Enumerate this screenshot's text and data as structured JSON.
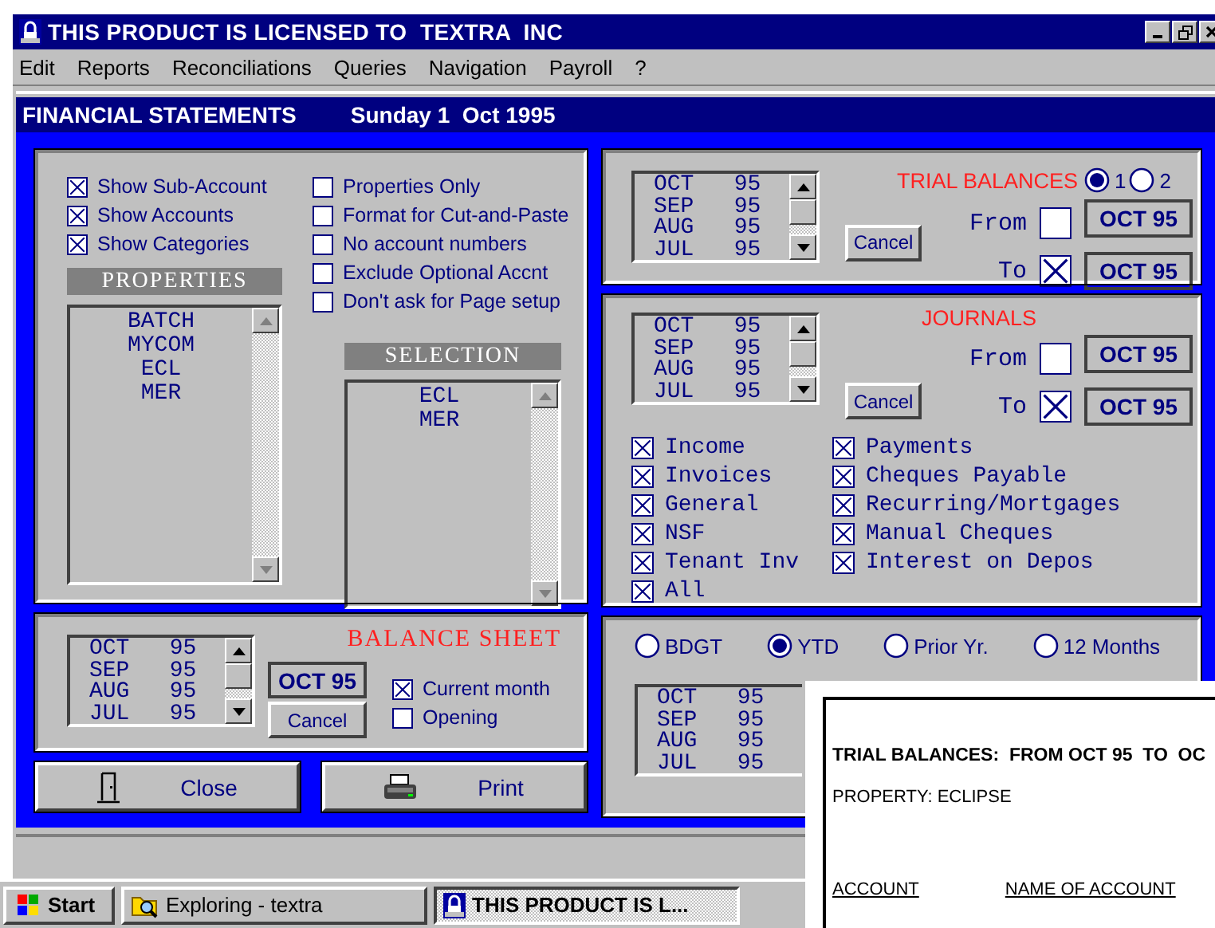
{
  "window": {
    "title": "THIS PRODUCT IS LICENSED TO  TEXTRA  INC"
  },
  "menu": [
    "Edit",
    "Reports",
    "Reconciliations",
    "Queries",
    "Navigation",
    "Payroll",
    "?"
  ],
  "dialog": {
    "title": "FINANCIAL STATEMENTS",
    "date": "Sunday 1  Oct 1995"
  },
  "options": {
    "left_checks": [
      {
        "label": "Show Sub-Account",
        "checked": true
      },
      {
        "label": "Show Accounts",
        "checked": true
      },
      {
        "label": "Show Categories",
        "checked": true
      }
    ],
    "right_checks": [
      {
        "label": "Properties Only",
        "checked": false
      },
      {
        "label": "Format for Cut-and-Paste",
        "checked": false
      },
      {
        "label": "No account numbers",
        "checked": false
      },
      {
        "label": "Exclude Optional Accnt",
        "checked": false
      },
      {
        "label": "Don't ask for Page setup",
        "checked": false
      }
    ],
    "properties": {
      "header": "PROPERTIES",
      "items": [
        "BATCH",
        "MYCOM",
        "ECL",
        "MER"
      ]
    },
    "selection": {
      "header": "SELECTION",
      "items": [
        "ECL",
        "MER"
      ]
    }
  },
  "trial_balances": {
    "title": "TRIAL BALANCES",
    "radios": [
      {
        "label": "1",
        "selected": true
      },
      {
        "label": "2",
        "selected": false
      }
    ],
    "months": [
      "OCT   95",
      "SEP   95",
      "AUG   95",
      "JUL   95"
    ],
    "cancel": "Cancel",
    "from": {
      "label": "From",
      "checked": false,
      "value": "OCT 95"
    },
    "to": {
      "label": "To",
      "checked": true,
      "value": "OCT 95"
    }
  },
  "journals": {
    "title": "JOURNALS",
    "months": [
      "OCT   95",
      "SEP   95",
      "AUG   95",
      "JUL   95"
    ],
    "cancel": "Cancel",
    "from": {
      "label": "From",
      "checked": false,
      "value": "OCT 95"
    },
    "to": {
      "label": "To",
      "checked": true,
      "value": "OCT 95"
    },
    "checks_left": [
      {
        "label": "Income",
        "checked": true
      },
      {
        "label": "Invoices",
        "checked": true
      },
      {
        "label": "General",
        "checked": true
      },
      {
        "label": "NSF",
        "checked": true
      },
      {
        "label": "Tenant Inv",
        "checked": true
      },
      {
        "label": "All",
        "checked": true
      }
    ],
    "checks_right": [
      {
        "label": "Payments",
        "checked": true
      },
      {
        "label": "Cheques Payable",
        "checked": true
      },
      {
        "label": "Recurring/Mortgages",
        "checked": true
      },
      {
        "label": "Manual Cheques",
        "checked": true
      },
      {
        "label": "Interest on Depos",
        "checked": true
      }
    ]
  },
  "balance_sheet": {
    "title": "BALANCE SHEET",
    "months": [
      "OCT   95",
      "SEP   95",
      "AUG   95",
      "JUL   95"
    ],
    "value": "OCT 95",
    "cancel": "Cancel",
    "checks": [
      {
        "label": "Current month",
        "checked": true
      },
      {
        "label": "Opening",
        "checked": false
      }
    ]
  },
  "buttons": [
    {
      "label": "Close",
      "kind": "close"
    },
    {
      "label": "Print",
      "kind": "print"
    }
  ],
  "income": {
    "radios": [
      {
        "label": "BDGT",
        "selected": false
      },
      {
        "label": "YTD",
        "selected": true
      },
      {
        "label": "Prior Yr.",
        "selected": false
      },
      {
        "label": "12 Months",
        "selected": false
      }
    ],
    "months": [
      "OCT   95",
      "SEP   95",
      "AUG   95",
      "JUL   95"
    ]
  },
  "report": {
    "title": "TRIAL BALANCES:  FROM OCT 95  TO  OC",
    "property": "PROPERTY: ECLIPSE",
    "columns": [
      "ACCOUNT",
      "NAME OF ACCOUNT"
    ]
  },
  "taskbar": {
    "start": "Start",
    "tasks": [
      {
        "label": "Exploring - textra",
        "selected": false,
        "kind": "explorer"
      },
      {
        "label": "THIS PRODUCT IS L...",
        "selected": true,
        "kind": "app"
      }
    ]
  }
}
